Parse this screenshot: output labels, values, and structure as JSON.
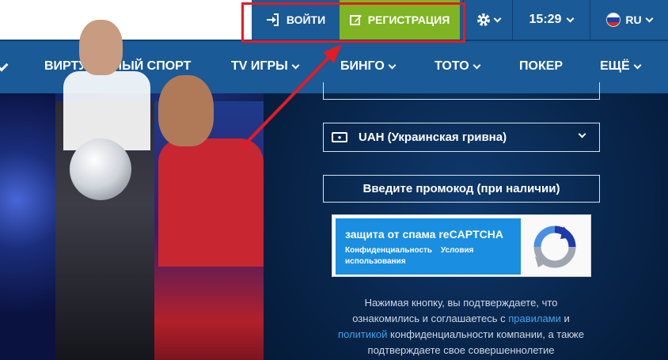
{
  "header": {
    "login_label": "ВОЙТИ",
    "register_label": "РЕГИСТРАЦИЯ",
    "time": "15:29",
    "lang": "RU"
  },
  "nav": {
    "items": [
      {
        "label": "ВИРТУАЛЬНЫЙ СПОРТ",
        "has_dropdown": false
      },
      {
        "label": "TV ИГРЫ",
        "has_dropdown": true
      },
      {
        "label": "БИНГО",
        "has_dropdown": true
      },
      {
        "label": "ТОТО",
        "has_dropdown": true
      },
      {
        "label": "ПОКЕР",
        "has_dropdown": false
      },
      {
        "label": "ЕЩЁ",
        "has_dropdown": true
      }
    ]
  },
  "form": {
    "currency": "UAH (Украинская гривна)",
    "promo": "Введите промокод (при наличии)",
    "captcha": {
      "title": "защита от спама reCAPTCHA",
      "privacy": "Конфиденциальность",
      "terms": "Условия использования"
    },
    "consent": {
      "part1": "Нажимая кнопку, вы подтверждаете, что ознакомились и соглашаетесь с ",
      "rules_link": "правилами",
      "part2": " и ",
      "policy_link": "политикой",
      "part3": " конфиденциальности компании, а также подтверждаете свое совершеннолетие"
    }
  },
  "colors": {
    "header_blue": "#1a5a96",
    "register_green": "#7fb422",
    "highlight_red": "#e31b23",
    "link_blue": "#3ea5ec"
  }
}
